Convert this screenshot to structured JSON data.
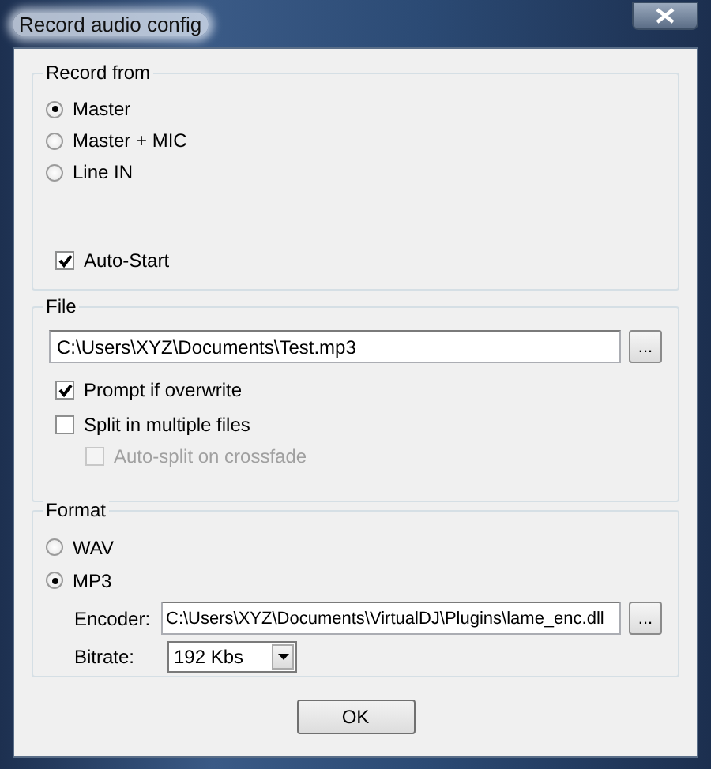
{
  "window": {
    "title": "Record audio config"
  },
  "record_from": {
    "title": "Record from",
    "options": [
      {
        "label": "Master",
        "selected": true
      },
      {
        "label": "Master + MIC",
        "selected": false
      },
      {
        "label": "Line IN",
        "selected": false
      }
    ],
    "auto_start": {
      "label": "Auto-Start",
      "checked": true
    }
  },
  "file": {
    "title": "File",
    "path": "C:\\Users\\XYZ\\Documents\\Test.mp3",
    "browse": "...",
    "options": [
      {
        "label": "Prompt if overwrite",
        "checked": true,
        "disabled": false
      },
      {
        "label": "Split in multiple files",
        "checked": false,
        "disabled": false,
        "children": [
          {
            "label": "Auto-split on crossfade",
            "checked": false,
            "disabled": true
          }
        ]
      }
    ]
  },
  "format": {
    "title": "Format",
    "options": [
      {
        "label": "WAV",
        "selected": false
      },
      {
        "label": "MP3",
        "selected": true
      }
    ],
    "encoder": {
      "label": "Encoder:",
      "value": "C:\\Users\\XYZ\\Documents\\VirtualDJ\\Plugins\\lame_enc.dll",
      "browse": "..."
    },
    "bitrate": {
      "label": "Bitrate:",
      "value": "192 Kbs"
    }
  },
  "buttons": [
    "OK"
  ]
}
